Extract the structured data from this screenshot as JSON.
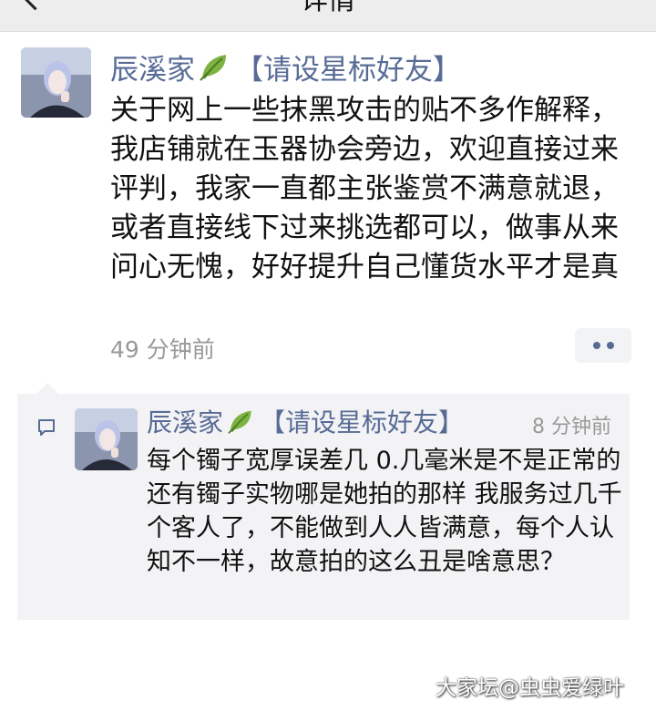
{
  "nav": {
    "title": "详情",
    "back_icon": "chevron-left-icon"
  },
  "post": {
    "author": "辰溪家",
    "author_tag": "【请设星标好友】",
    "leaf_icon": "leaf-emoji-icon",
    "text": "关于网上一些抹黑攻击的贴不多作解释，我店铺就在玉器协会旁边，欢迎直接过来评判，我家一直都主张鉴赏不满意就退，或者直接线下过来挑选都可以，做事从来问心无愧，好好提升自己懂货水平才是真",
    "time": "49 分钟前",
    "more_icon": "more-dots-icon"
  },
  "comment": {
    "icon": "comment-bubble-icon",
    "author": "辰溪家",
    "author_tag": "【请设星标好友】",
    "time": "8 分钟前",
    "text": "每个镯子宽厚误差几 0.几毫米是不是正常的 还有镯子实物哪是她拍的那样 我服务过几千个客人了，不能做到人人皆满意，每个人认知不一样，故意拍的这么丑是啥意思？"
  },
  "watermark": "大家坛@虫虫爱绿叶",
  "colors": {
    "link_blue": "#576b95",
    "time_gray": "#999999",
    "comment_bg": "#f3f3f5",
    "nav_bg": "#ededed"
  }
}
